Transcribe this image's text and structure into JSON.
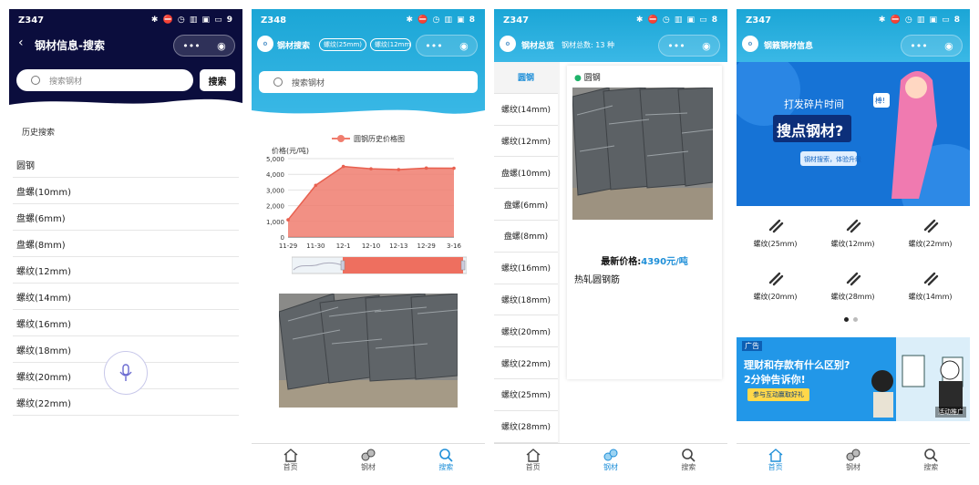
{
  "phone1": {
    "status": {
      "time": "Z347",
      "icons": "✱ ⛔ ◷ ▥ ▣ ▭ 9"
    },
    "title": "钢材信息-搜索",
    "search_placeholder": "搜索钢材",
    "search_button": "搜索",
    "history_label": "历史搜索",
    "items": [
      "圆钢",
      "盘螺(10mm)",
      "盘螺(6mm)",
      "盘螺(8mm)",
      "螺纹(12mm)",
      "螺纹(14mm)",
      "螺纹(16mm)",
      "螺纹(18mm)",
      "螺纹(20mm)",
      "螺纹(22mm)"
    ]
  },
  "phone2": {
    "status": {
      "time": "Z348",
      "icons": "✱ ⛔ ◷ ▥ ▣ 8"
    },
    "title": "钢材搜索",
    "pills": [
      "螺纹(25mm)",
      "螺纹(12mm"
    ],
    "search_placeholder": "搜索钢材",
    "tabs": [
      "首页",
      "钢材",
      "搜索"
    ]
  },
  "chart_data": {
    "type": "area",
    "legend": "圆钢历史价格图",
    "ylabel": "价格(元/吨)",
    "categories": [
      "11-29",
      "11-30",
      "12-1",
      "12-10",
      "12-13",
      "12-29",
      "3-16"
    ],
    "series": [
      {
        "name": "圆钢历史价格图",
        "values": [
          1100,
          3300,
          4500,
          4350,
          4300,
          4400,
          4390
        ]
      }
    ],
    "ylim": [
      0,
      5000
    ],
    "yticks": [
      "5,000",
      "4,000",
      "3,000",
      "2,000",
      "1,000",
      "0"
    ],
    "color": "#f07d6e"
  },
  "phone3": {
    "status": {
      "time": "Z347",
      "icons": "✱ ⛔ ◷ ▥ ▣ ▭ 8"
    },
    "title": "钢材总览",
    "total": "钢材总数: 13 种",
    "categories": [
      "圆钢",
      "螺纹(14mm)",
      "螺纹(12mm)",
      "盘螺(10mm)",
      "盘螺(6mm)",
      "盘螺(8mm)",
      "螺纹(16mm)",
      "螺纹(18mm)",
      "螺纹(20mm)",
      "螺纹(22mm)",
      "螺纹(25mm)",
      "螺纹(28mm)"
    ],
    "card_heading": "圆钢",
    "price_label": "最新价格:",
    "price_value": "4390元/吨",
    "product_name": "热轧圆钢筋",
    "tabs": [
      "首页",
      "钢材",
      "搜索"
    ]
  },
  "phone4": {
    "status": {
      "time": "Z347",
      "icons": "✱ ⛔ ◷ ▥ ▣ ▭ 8"
    },
    "title": "钢籁钢材信息",
    "banner": {
      "top": "打发碎片时间",
      "main": "搜点钢材?",
      "sub": "钢材搜索，体验升级",
      "badge": "棒!"
    },
    "grid": [
      "螺纹(25mm)",
      "螺纹(12mm)",
      "螺纹(22mm)",
      "螺纹(20mm)",
      "螺纹(28mm)",
      "螺纹(14mm)"
    ],
    "ad": {
      "tag": "广告",
      "line1": "理财和存款有什么区别?",
      "line2": "2分钟告诉你!",
      "cta": "参与互动赢取好礼",
      "corner": "活动推广"
    },
    "tabs": [
      "首页",
      "钢材",
      "搜索"
    ]
  }
}
